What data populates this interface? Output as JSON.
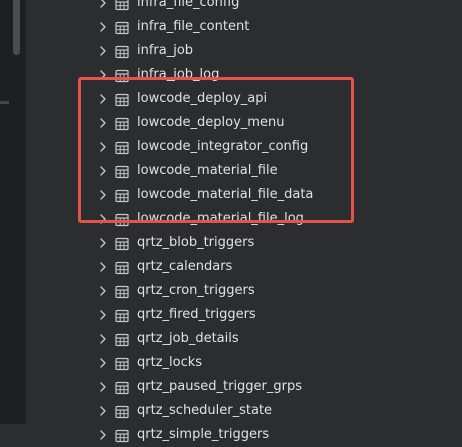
{
  "tree": {
    "items": [
      {
        "label": "infra_file_config"
      },
      {
        "label": "infra_file_content"
      },
      {
        "label": "infra_job"
      },
      {
        "label": "infra_job_log"
      },
      {
        "label": "lowcode_deploy_api"
      },
      {
        "label": "lowcode_deploy_menu"
      },
      {
        "label": "lowcode_integrator_config"
      },
      {
        "label": "lowcode_material_file"
      },
      {
        "label": "lowcode_material_file_data"
      },
      {
        "label": "lowcode_material_file_log"
      },
      {
        "label": "qrtz_blob_triggers"
      },
      {
        "label": "qrtz_calendars"
      },
      {
        "label": "qrtz_cron_triggers"
      },
      {
        "label": "qrtz_fired_triggers"
      },
      {
        "label": "qrtz_job_details"
      },
      {
        "label": "qrtz_locks"
      },
      {
        "label": "qrtz_paused_trigger_grps"
      },
      {
        "label": "qrtz_scheduler_state"
      },
      {
        "label": "qrtz_simple_triggers"
      }
    ]
  },
  "colors": {
    "background": "#2b2d30",
    "text": "#dfe1e5",
    "icon": "#c4c7cc",
    "highlight": "#e5534b"
  },
  "icons": {
    "expand": "chevron-right-icon",
    "table": "table-icon"
  }
}
